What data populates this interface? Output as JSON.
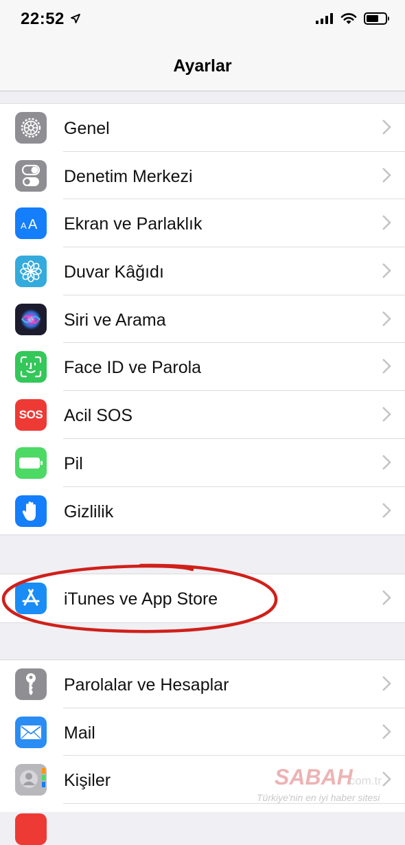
{
  "status": {
    "time": "22:52"
  },
  "nav": {
    "title": "Ayarlar"
  },
  "groups": [
    {
      "items": [
        {
          "label": "Genel",
          "icon": "gear-icon",
          "color": "#8e8e93"
        },
        {
          "label": "Denetim Merkezi",
          "icon": "toggle-icon",
          "color": "#8e8e93"
        },
        {
          "label": "Ekran ve Parlaklık",
          "icon": "text-size-icon",
          "color": "#147efb"
        },
        {
          "label": "Duvar Kâğıdı",
          "icon": "flower-icon",
          "color": "#35aadc"
        },
        {
          "label": "Siri ve Arama",
          "icon": "siri-icon",
          "color": "#1c1c2e"
        },
        {
          "label": "Face ID ve Parola",
          "icon": "face-id-icon",
          "color": "#34c759"
        },
        {
          "label": "Acil SOS",
          "icon": "sos-icon",
          "color": "#ee3a35",
          "icon_text": "SOS"
        },
        {
          "label": "Pil",
          "icon": "battery-icon",
          "color": "#4cd964"
        },
        {
          "label": "Gizlilik",
          "icon": "hand-icon",
          "color": "#147efb"
        }
      ]
    },
    {
      "items": [
        {
          "label": "iTunes ve App Store",
          "icon": "app-store-icon",
          "color": "#1a8cf5"
        }
      ]
    },
    {
      "items": [
        {
          "label": "Parolalar ve Hesaplar",
          "icon": "key-icon",
          "color": "#8e8e93"
        },
        {
          "label": "Mail",
          "icon": "mail-icon",
          "color": "#2b8cf4"
        },
        {
          "label": "Kişiler",
          "icon": "contacts-icon",
          "color": "#a9a9ae"
        }
      ]
    }
  ],
  "annotation": {
    "color": "#d0201a"
  },
  "watermark": {
    "brand": "SABAH",
    "domain": ".com.tr",
    "tagline": "Türkiye'nin en iyi haber sitesi"
  }
}
